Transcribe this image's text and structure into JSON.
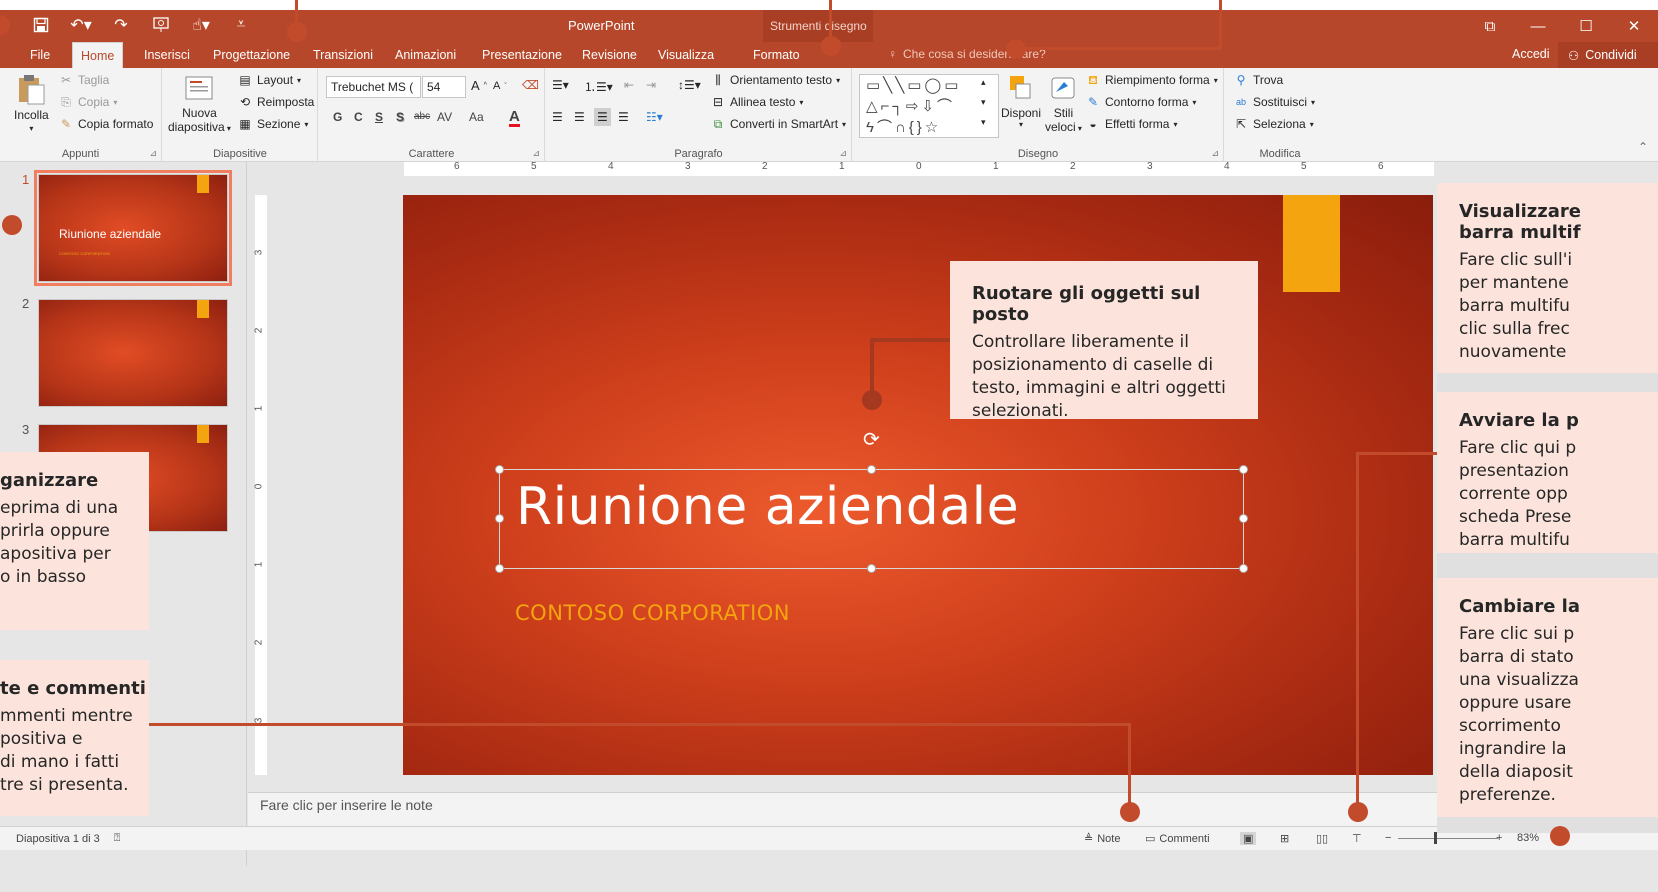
{
  "titlebar": {
    "app_title": "PowerPoint",
    "context_title": "Strumenti disegno",
    "qat_icons": [
      "save-icon",
      "undo-icon",
      "redo-icon",
      "presentation-start-icon",
      "touch-mode-icon",
      "customize-icon"
    ]
  },
  "tabs": {
    "file": "File",
    "home": "Home",
    "insert": "Inserisci",
    "design": "Progettazione",
    "transitions": "Transizioni",
    "animations": "Animazioni",
    "slideshow": "Presentazione",
    "review": "Revisione",
    "view": "Visualizza",
    "format": "Formato",
    "tellme_placeholder": "Che cosa si desidera fare?",
    "signin": "Accedi",
    "share": "Condividi"
  },
  "ribbon": {
    "clipboard": {
      "paste": "Incolla",
      "cut": "Taglia",
      "copy": "Copia",
      "format_painter": "Copia formato",
      "label": "Appunti"
    },
    "slides": {
      "new_slide_line1": "Nuova",
      "new_slide_line2": "diapositiva",
      "layout": "Layout",
      "reset": "Reimposta",
      "section": "Sezione",
      "label": "Diapositive"
    },
    "font": {
      "font_name": "Trebuchet MS (",
      "font_size": "54",
      "bold": "G",
      "italic": "C",
      "underline": "S",
      "shadow": "S",
      "strike": "abc",
      "spacing": "AV",
      "case": "Aa",
      "color": "A",
      "label": "Carattere"
    },
    "paragraph": {
      "text_direction": "Orientamento testo",
      "align_text": "Allinea testo",
      "smartart": "Converti in SmartArt",
      "label": "Paragrafo"
    },
    "drawing": {
      "arrange": "Disponi",
      "quick_styles_line1": "Stili",
      "quick_styles_line2": "veloci",
      "shape_fill": "Riempimento forma",
      "shape_outline": "Contorno forma",
      "shape_effects": "Effetti forma",
      "label": "Disegno"
    },
    "editing": {
      "find": "Trova",
      "replace": "Sostituisci",
      "select": "Seleziona",
      "label": "Modifica"
    }
  },
  "ruler": {
    "h_ticks": [
      "6",
      "5",
      "4",
      "3",
      "2",
      "1",
      "0",
      "1",
      "2",
      "3",
      "4",
      "5",
      "6"
    ],
    "v_ticks": [
      "3",
      "2",
      "1",
      "0",
      "1",
      "2",
      "3"
    ]
  },
  "thumbnails": [
    {
      "number": "1",
      "title": "Riunione aziendale",
      "subtitle": "CONTOSO CORPORATION"
    },
    {
      "number": "2"
    },
    {
      "number": "3"
    }
  ],
  "slide": {
    "title": "Riunione aziendale",
    "subtitle": "CONTOSO CORPORATION"
  },
  "notes": {
    "placeholder": "Fare clic per inserire le note"
  },
  "statusbar": {
    "slide_info": "Diapositiva 1 di 3",
    "notes": "Note",
    "comments": "Commenti",
    "zoom": "83%"
  },
  "callouts": {
    "rotate": {
      "title": "Ruotare gli oggetti sul posto",
      "body": "Controllare liberamente il posizionamento di caselle di testo, immagini e altri oggetti selezionati."
    },
    "organize": {
      "title": "ganizzare",
      "body": "eprima di una\nprirla oppure\napositiva per\no in basso"
    },
    "notes": {
      "title": "te e commenti",
      "body": "mmenti mentre\npositiva e\ndi mano i fatti\ntre si presenta."
    },
    "ribbon": {
      "title": "Visualizzare\nbarra multif",
      "body": "Fare clic sull'i\nper mantene\nbarra multifu\nclic sulla frec\nnuovamente"
    },
    "present": {
      "title": "Avviare la p",
      "body": "Fare clic qui p\npresentazion\ncorrente opp\nscheda Prese\nbarra multifu"
    },
    "view": {
      "title": "Cambiare la",
      "body": "Fare clic sui p\nbarra di stato\nuna visualizza\noppure usare\nscorrimento\ningrandire la\ndella diaposit\npreferenze."
    }
  },
  "colors": {
    "accent": "#b7472a",
    "callout_bg": "#fce4dc",
    "callout_dot": "#c24b2c",
    "slide_tag": "#f3a40f"
  }
}
